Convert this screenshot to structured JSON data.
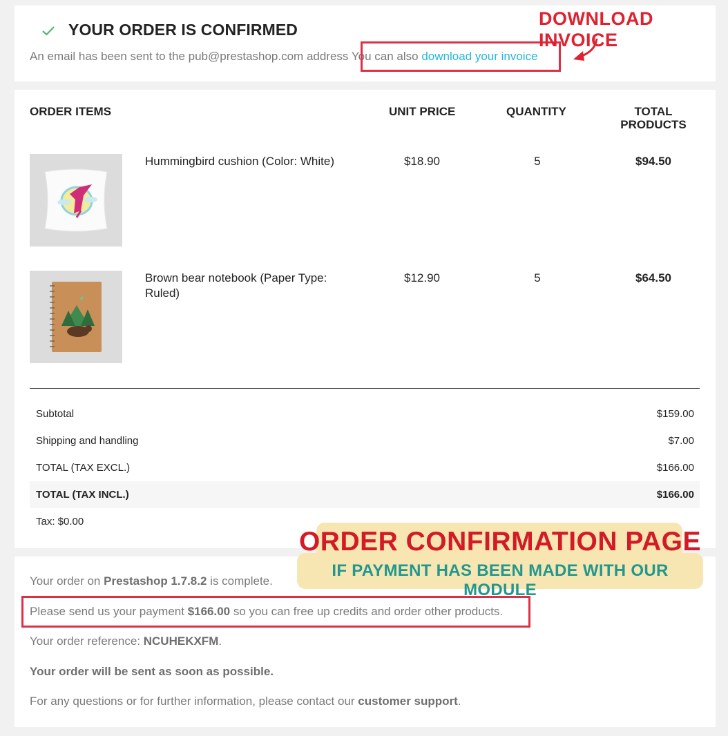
{
  "confirmation": {
    "title": "YOUR ORDER IS CONFIRMED",
    "email_text": "An email has been sent to the pub@prestashop.com address",
    "invoice_prefix": "You can also",
    "invoice_link": "download your invoice"
  },
  "table": {
    "headers": {
      "items": "ORDER ITEMS",
      "unit_price": "UNIT PRICE",
      "quantity": "QUANTITY",
      "total_line1": "TOTAL",
      "total_line2": "PRODUCTS"
    },
    "rows": [
      {
        "name": "Hummingbird cushion (Color: White)",
        "unit_price": "$18.90",
        "quantity": "5",
        "total": "$94.50"
      },
      {
        "name": "Brown bear notebook (Paper Type: Ruled)",
        "unit_price": "$12.90",
        "quantity": "5",
        "total": "$64.50"
      }
    ]
  },
  "totals": [
    {
      "label": "Subtotal",
      "value": "$159.00"
    },
    {
      "label": "Shipping and handling",
      "value": "$7.00"
    },
    {
      "label": "TOTAL (TAX EXCL.)",
      "value": "$166.00"
    },
    {
      "label": "TOTAL (TAX INCL.)",
      "value": "$166.00"
    }
  ],
  "tax": "Tax: $0.00",
  "details": {
    "complete_prefix": "Your order on ",
    "shop_name": "Prestashop 1.7.8.2",
    "complete_suffix": " is complete.",
    "payment_prefix": "Please send us your payment ",
    "payment_amount": "$166.00",
    "payment_suffix": " so you can free up credits and order other products.",
    "reference_prefix": "Your order reference: ",
    "reference": "NCUHEKXFM",
    "reference_suffix": ".",
    "shipping_note": "Your order will be sent as soon as possible.",
    "support_prefix": "For any questions or for further information, please contact our ",
    "support_link": "customer support",
    "support_suffix": "."
  },
  "annotations": {
    "invoice_label": "DOWNLOAD INVOICE",
    "banner_title": "ORDER CONFIRMATION PAGE",
    "banner_subtitle": "IF PAYMENT HAS BEEN MADE WITH OUR MODULE"
  },
  "colors": {
    "accent_link": "#24b9d7",
    "highlight_red": "#df2f45",
    "check_green": "#4cbb6c",
    "banner_bg": "#f7e6b2",
    "banner_teal": "#22978f"
  },
  "icons": {
    "check": "check-icon",
    "arrow": "curved-arrow-icon"
  }
}
